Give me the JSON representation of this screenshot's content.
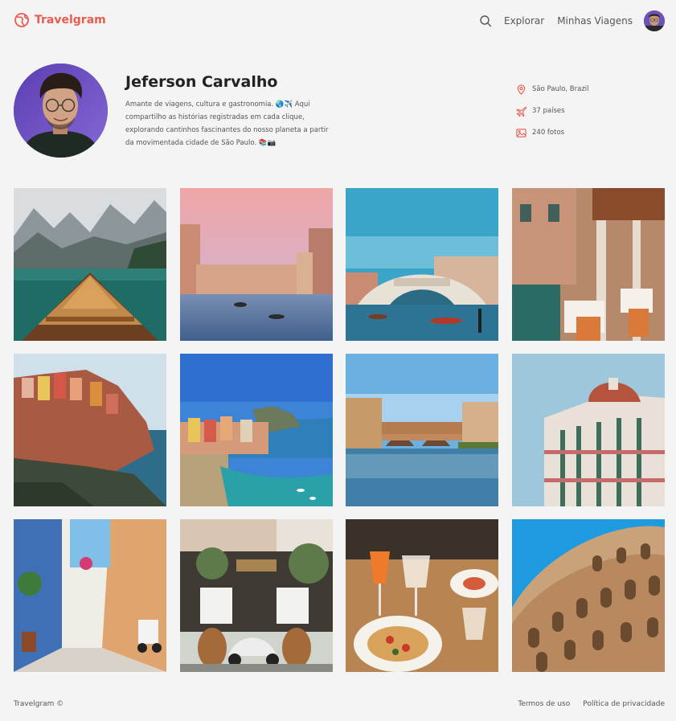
{
  "header": {
    "brand": "Travelgram",
    "brand_color": "#e65c4f",
    "nav": [
      "Explorar",
      "Minhas Viagens"
    ],
    "icons": {
      "search": "search-icon",
      "avatar": "user-avatar"
    }
  },
  "profile": {
    "name": "Jeferson Carvalho",
    "bio": "Amante de viagens, cultura e gastronomia. 🌏✈️ Aqui compartilho as histórias registradas em cada clique, explorando cantinhos fascinantes do nosso planeta a partir da movimentada cidade de São Paulo. 📚📷",
    "location": "São Paulo, Brazil",
    "countries": "37 países",
    "photos": "240 fotos"
  },
  "gallery": [
    "lake-boat-mountains",
    "venice-canal-sunset",
    "rialto-bridge",
    "venice-restaurant-canal",
    "cinque-terre-cliffs",
    "vernazza-harbor",
    "ponte-vecchio",
    "florence-duomo",
    "italian-alley-scooter",
    "scooter-cafe-barrels",
    "aperol-pasta-dinner",
    "colosseum"
  ],
  "footer": {
    "copyright": "Travelgram ©",
    "terms": "Termos de uso",
    "privacy": "Política de privacidade"
  }
}
